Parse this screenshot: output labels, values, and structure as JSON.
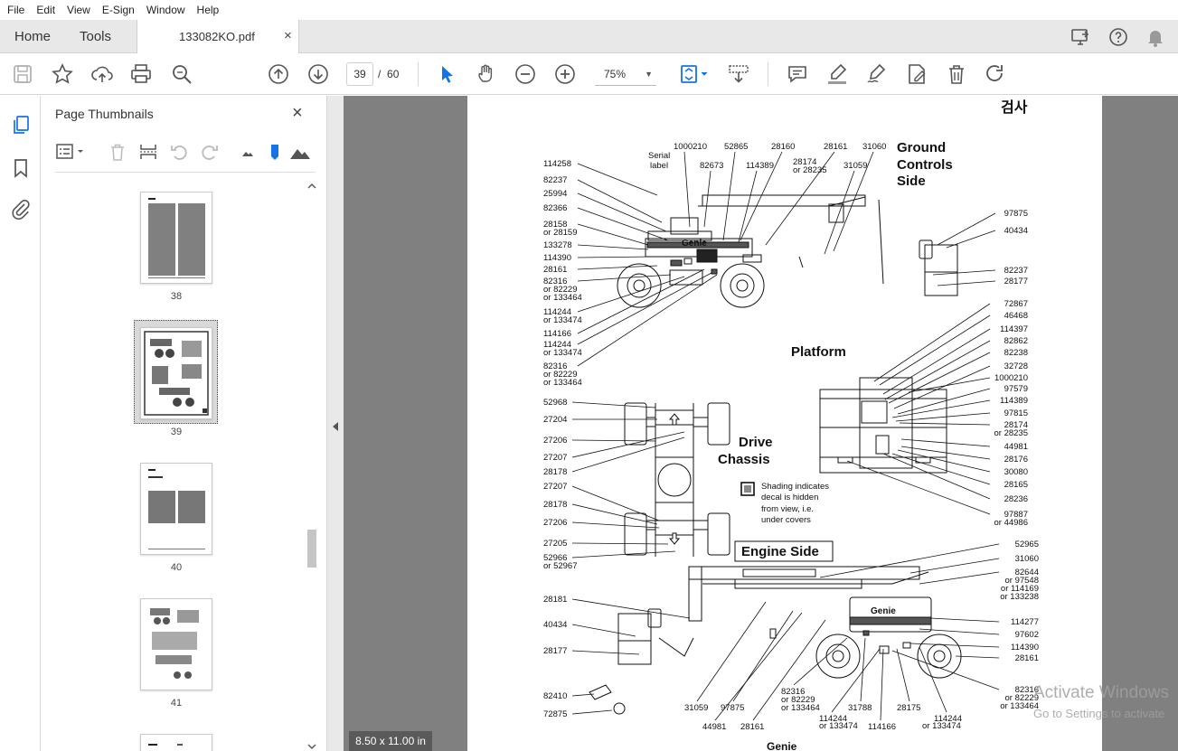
{
  "menu": [
    "File",
    "Edit",
    "View",
    "E-Sign",
    "Window",
    "Help"
  ],
  "tabs": {
    "home": "Home",
    "tools": "Tools",
    "document": "133082KO.pdf",
    "close": "×"
  },
  "toolbar": {
    "current_page": "39",
    "page_separator": "/",
    "total_pages": "60",
    "zoom": "75%"
  },
  "panel": {
    "title": "Page Thumbnails",
    "close": "×",
    "thumbnails": [
      {
        "label": "38"
      },
      {
        "label": "39",
        "selected": true
      },
      {
        "label": "40"
      },
      {
        "label": "41"
      },
      {
        "label": ""
      }
    ]
  },
  "document": {
    "header": "검사",
    "footer": "Genie",
    "sections": {
      "ground": [
        "Ground",
        "Controls",
        "Side"
      ],
      "platform": "Platform",
      "drive": [
        "Drive",
        "Chassis"
      ],
      "engine": "Engine Side"
    },
    "shading_note": [
      "Shading indicates",
      "decal is hidden",
      "from view, i.e.",
      "under covers"
    ],
    "serial_label": [
      "Serial",
      "label"
    ],
    "ground_left_labels": [
      "114258",
      "82237",
      "25994",
      "82366",
      "28158",
      "or 28159",
      "133278",
      "114390",
      "28161",
      "82316",
      "or 82229",
      "or 133464",
      "114244",
      "or 133474",
      "114166",
      "114244",
      "or 133474",
      "82316",
      "or 82229",
      "or 133464"
    ],
    "ground_top_labels": [
      "1000210",
      "52865",
      "28160",
      "28161",
      "31060",
      "82673",
      "114389",
      "28174",
      "or 28235",
      "31059"
    ],
    "ground_right_labels": [
      "97875",
      "40434",
      "82237",
      "28177"
    ],
    "platform_labels": [
      "72867",
      "46468",
      "114397",
      "82862",
      "82238",
      "32728",
      "1000210",
      "97579",
      "114389",
      "97815",
      "28174",
      "or 28235",
      "44981",
      "28176",
      "30080",
      "28165",
      "28236",
      "97887",
      "or 44986"
    ],
    "drive_labels": [
      "52968",
      "27204",
      "27206",
      "27207",
      "28178",
      "27207",
      "28178",
      "27206",
      "27205",
      "52966",
      "or 52967"
    ],
    "engine_left_labels": [
      "28181",
      "40434",
      "28177",
      "82410",
      "72875"
    ],
    "engine_right_labels": [
      "52965",
      "31060",
      "82644",
      "or 97548",
      "or 114169",
      "or 133238",
      "114277",
      "97602",
      "114390",
      "28161",
      "82316",
      "or 82229",
      "or 133464"
    ],
    "engine_bottom_labels": [
      "31059",
      "97875",
      "44981",
      "28161",
      "82316",
      "or 82229",
      "or 133464",
      "31788",
      "114244",
      "or 133474",
      "114166",
      "28175",
      "114244",
      "or 133474"
    ],
    "machine_brand": "Genie"
  },
  "status": {
    "page_size": "8.50 x 11.00 in"
  },
  "watermark": {
    "line1": "Activate Windows",
    "line2": "Go to Settings to activate"
  },
  "colors": {
    "accent": "#1473e6",
    "doc_background": "#808080",
    "tab_bar": "#e8e8e8"
  }
}
